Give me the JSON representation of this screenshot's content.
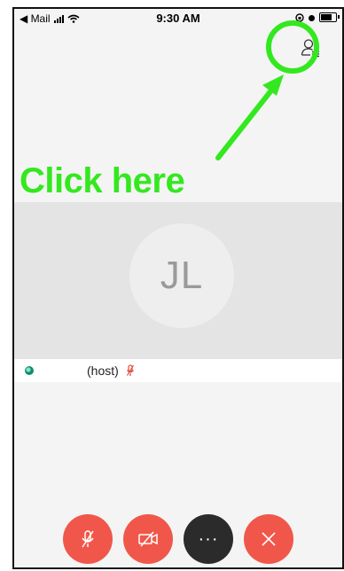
{
  "status_bar": {
    "back_app": "◀ Mail",
    "time": "9:30 AM"
  },
  "annotation": {
    "label": "Click here",
    "color": "#33e81f"
  },
  "video": {
    "avatar_initials": "JL"
  },
  "participant": {
    "name": "(host)",
    "muted": true
  },
  "controls": {
    "more_label": "···"
  },
  "colors": {
    "end_red": "#f0574a",
    "dark_button": "#2b2b2b",
    "mic_muted": "#e04a3a"
  },
  "icons": [
    "wifi-icon",
    "signal-icon",
    "battery-icon",
    "participants-icon",
    "mic-muted-icon",
    "video-off-icon",
    "more-icon",
    "close-icon"
  ]
}
